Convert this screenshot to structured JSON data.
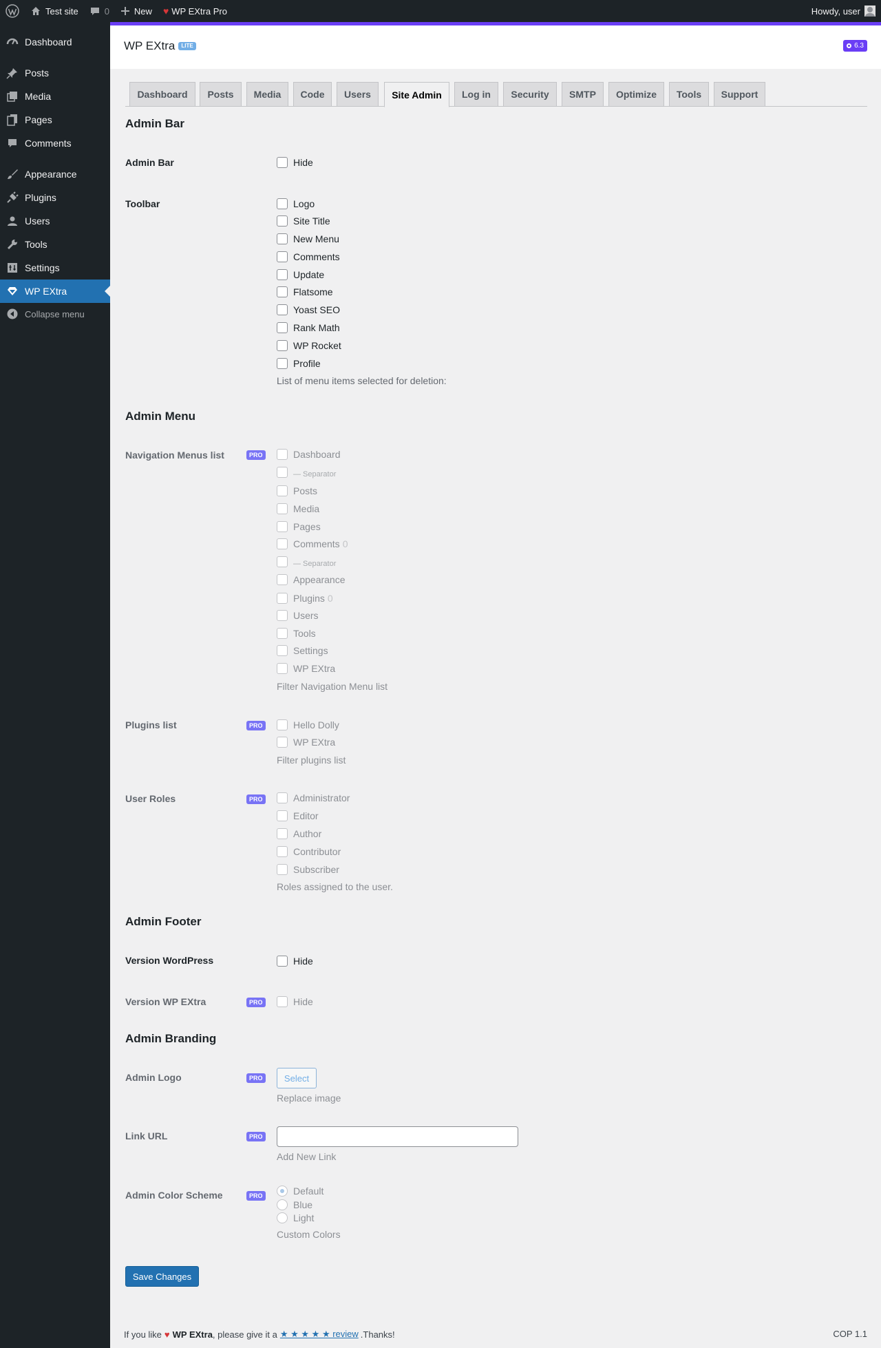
{
  "admin_bar": {
    "site_name": "Test site",
    "comments_count": "0",
    "new_label": "New",
    "pro_label": "WP EXtra Pro",
    "howdy": "Howdy, user"
  },
  "sidebar": {
    "items": [
      {
        "label": "Dashboard",
        "icon": "dashboard-icon"
      },
      {
        "label": "Posts",
        "icon": "pin-icon"
      },
      {
        "label": "Media",
        "icon": "media-icon"
      },
      {
        "label": "Pages",
        "icon": "pages-icon"
      },
      {
        "label": "Comments",
        "icon": "comment-icon"
      },
      {
        "label": "Appearance",
        "icon": "brush-icon"
      },
      {
        "label": "Plugins",
        "icon": "plug-icon"
      },
      {
        "label": "Users",
        "icon": "user-icon"
      },
      {
        "label": "Tools",
        "icon": "wrench-icon"
      },
      {
        "label": "Settings",
        "icon": "settings-icon"
      },
      {
        "label": "WP EXtra",
        "icon": "diamond-icon"
      }
    ],
    "collapse_label": "Collapse menu",
    "current": "WP EXtra"
  },
  "header": {
    "title": "WP EXtra",
    "badge": "LITE",
    "version": "6.3"
  },
  "tabs": [
    "Dashboard",
    "Posts",
    "Media",
    "Code",
    "Users",
    "Site Admin",
    "Log in",
    "Security",
    "SMTP",
    "Optimize",
    "Tools",
    "Support"
  ],
  "active_tab": "Site Admin",
  "pro_badge": "PRO",
  "admin_bar_section": {
    "title": "Admin Bar",
    "admin_bar_label": "Admin Bar",
    "hide_label": "Hide",
    "toolbar_label": "Toolbar",
    "toolbar_options": [
      "Logo",
      "Site Title",
      "New Menu",
      "Comments",
      "Update",
      "Flatsome",
      "Yoast SEO",
      "Rank Math",
      "WP Rocket",
      "Profile"
    ],
    "toolbar_desc": "List of menu items selected for deletion:"
  },
  "admin_menu_section": {
    "title": "Admin Menu",
    "nav_label": "Navigation Menus list",
    "nav_options": [
      {
        "label": "Dashboard",
        "count": ""
      },
      {
        "label": "— Separator",
        "count": "",
        "separator": true
      },
      {
        "label": "Posts",
        "count": ""
      },
      {
        "label": "Media",
        "count": ""
      },
      {
        "label": "Pages",
        "count": ""
      },
      {
        "label": "Comments",
        "count": "0"
      },
      {
        "label": "— Separator",
        "count": "",
        "separator": true
      },
      {
        "label": "Appearance",
        "count": ""
      },
      {
        "label": "Plugins",
        "count": "0"
      },
      {
        "label": "Users",
        "count": ""
      },
      {
        "label": "Tools",
        "count": ""
      },
      {
        "label": "Settings",
        "count": ""
      },
      {
        "label": "WP EXtra",
        "count": ""
      }
    ],
    "nav_desc": "Filter Navigation Menu list",
    "plugins_label": "Plugins list",
    "plugins_options": [
      "Hello Dolly",
      "WP EXtra"
    ],
    "plugins_desc": "Filter plugins list",
    "roles_label": "User Roles",
    "roles_options": [
      "Administrator",
      "Editor",
      "Author",
      "Contributor",
      "Subscriber"
    ],
    "roles_desc": "Roles assigned to the user."
  },
  "admin_footer_section": {
    "title": "Admin Footer",
    "version_wp_label": "Version WordPress",
    "version_wpextra_label": "Version WP EXtra",
    "hide_label": "Hide"
  },
  "admin_branding_section": {
    "title": "Admin Branding",
    "logo_label": "Admin Logo",
    "select_label": "Select",
    "logo_desc": "Replace image",
    "link_label": "Link URL",
    "link_value": "",
    "link_desc": "Add New Link",
    "color_label": "Admin Color Scheme",
    "color_options": [
      "Default",
      "Blue",
      "Light"
    ],
    "color_selected": "Default",
    "color_desc": "Custom Colors"
  },
  "save_label": "Save Changes",
  "footer": {
    "prefix": "If you like",
    "plugin": "WP EXtra",
    "middle": ", please give it a",
    "link": "★ ★ ★ ★ ★ review",
    "suffix": ".Thanks!",
    "version": "COP 1.1"
  }
}
